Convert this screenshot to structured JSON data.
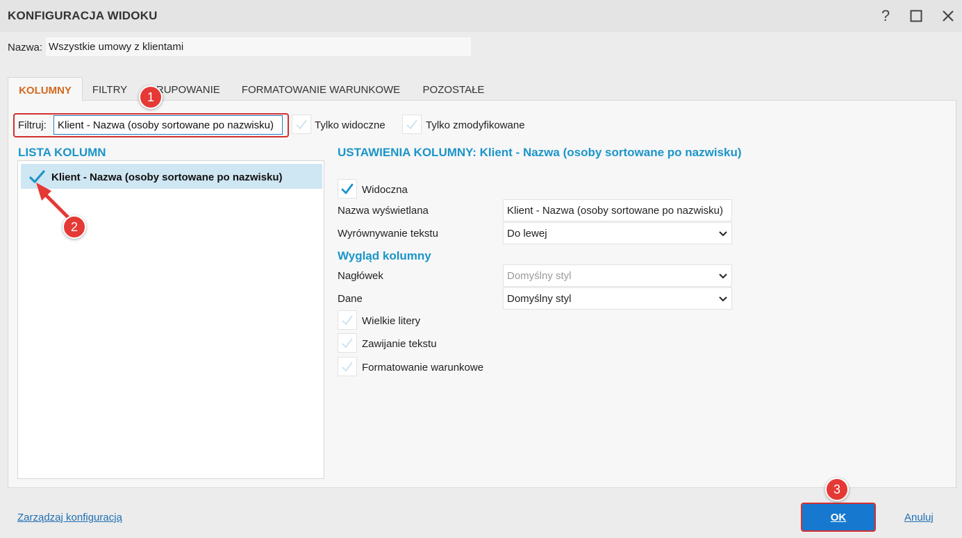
{
  "window": {
    "title": "KONFIGURACJA WIDOKU",
    "help_icon": "?"
  },
  "name_row": {
    "label": "Nazwa:",
    "value": "Wszystkie umowy z klientami"
  },
  "tabs": [
    {
      "label": "KOLUMNY",
      "active": true
    },
    {
      "label": "FILTRY",
      "active": false
    },
    {
      "label": "GRUPOWANIE",
      "active": false
    },
    {
      "label": "FORMATOWANIE WARUNKOWE",
      "active": false
    },
    {
      "label": "POZOSTAŁE",
      "active": false
    }
  ],
  "filter": {
    "label": "Filtruj:",
    "value": "Klient - Nazwa (osoby sortowane po nazwisku)",
    "only_visible_label": "Tylko widoczne",
    "only_modified_label": "Tylko zmodyfikowane"
  },
  "column_list": {
    "heading": "LISTA KOLUMN",
    "items": [
      {
        "label": "Klient - Nazwa (osoby sortowane po nazwisku)",
        "checked": true
      }
    ]
  },
  "settings": {
    "heading": "USTAWIENIA KOLUMNY: Klient - Nazwa (osoby sortowane po nazwisku)",
    "visible_label": "Widoczna",
    "display_name_label": "Nazwa wyświetlana",
    "display_name_value": "Klient - Nazwa (osoby sortowane po nazwisku)",
    "alignment_label": "Wyrównywanie tekstu",
    "alignment_value": "Do lewej",
    "appearance_heading": "Wygląd kolumny",
    "header_label": "Nagłówek",
    "header_value": "Domyślny styl",
    "data_label": "Dane",
    "data_value": "Domyślny styl",
    "uppercase_label": "Wielkie litery",
    "wrap_label": "Zawijanie tekstu",
    "conditional_label": "Formatowanie warunkowe"
  },
  "annotations": {
    "one": "1",
    "two": "2",
    "three": "3"
  },
  "footer": {
    "manage_label": "Zarządzaj konfiguracją",
    "ok_label": "OK",
    "cancel_label": "Anuluj"
  },
  "colors": {
    "accent_blue": "#1a95c9",
    "active_tab": "#d2691e",
    "ok_button": "#1679cf",
    "annotation_red": "#e53935",
    "selection": "#cfe6f3"
  }
}
